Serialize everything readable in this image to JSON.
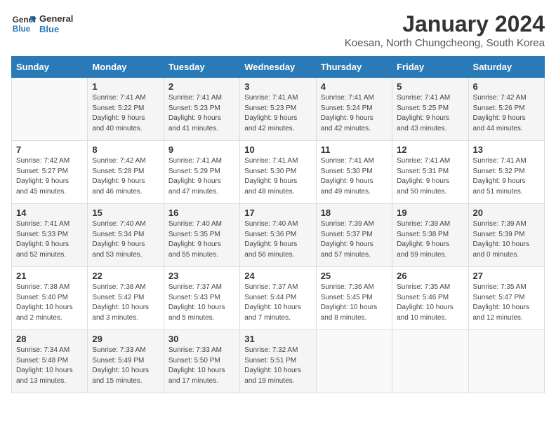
{
  "logo": {
    "line1": "General",
    "line2": "Blue"
  },
  "title": "January 2024",
  "subtitle": "Koesan, North Chungcheong, South Korea",
  "days_header": [
    "Sunday",
    "Monday",
    "Tuesday",
    "Wednesday",
    "Thursday",
    "Friday",
    "Saturday"
  ],
  "weeks": [
    [
      {
        "day": "",
        "sunrise": "",
        "sunset": "",
        "daylight": ""
      },
      {
        "day": "1",
        "sunrise": "Sunrise: 7:41 AM",
        "sunset": "Sunset: 5:22 PM",
        "daylight": "Daylight: 9 hours and 40 minutes."
      },
      {
        "day": "2",
        "sunrise": "Sunrise: 7:41 AM",
        "sunset": "Sunset: 5:23 PM",
        "daylight": "Daylight: 9 hours and 41 minutes."
      },
      {
        "day": "3",
        "sunrise": "Sunrise: 7:41 AM",
        "sunset": "Sunset: 5:23 PM",
        "daylight": "Daylight: 9 hours and 42 minutes."
      },
      {
        "day": "4",
        "sunrise": "Sunrise: 7:41 AM",
        "sunset": "Sunset: 5:24 PM",
        "daylight": "Daylight: 9 hours and 42 minutes."
      },
      {
        "day": "5",
        "sunrise": "Sunrise: 7:41 AM",
        "sunset": "Sunset: 5:25 PM",
        "daylight": "Daylight: 9 hours and 43 minutes."
      },
      {
        "day": "6",
        "sunrise": "Sunrise: 7:42 AM",
        "sunset": "Sunset: 5:26 PM",
        "daylight": "Daylight: 9 hours and 44 minutes."
      }
    ],
    [
      {
        "day": "7",
        "sunrise": "Sunrise: 7:42 AM",
        "sunset": "Sunset: 5:27 PM",
        "daylight": "Daylight: 9 hours and 45 minutes."
      },
      {
        "day": "8",
        "sunrise": "Sunrise: 7:42 AM",
        "sunset": "Sunset: 5:28 PM",
        "daylight": "Daylight: 9 hours and 46 minutes."
      },
      {
        "day": "9",
        "sunrise": "Sunrise: 7:41 AM",
        "sunset": "Sunset: 5:29 PM",
        "daylight": "Daylight: 9 hours and 47 minutes."
      },
      {
        "day": "10",
        "sunrise": "Sunrise: 7:41 AM",
        "sunset": "Sunset: 5:30 PM",
        "daylight": "Daylight: 9 hours and 48 minutes."
      },
      {
        "day": "11",
        "sunrise": "Sunrise: 7:41 AM",
        "sunset": "Sunset: 5:30 PM",
        "daylight": "Daylight: 9 hours and 49 minutes."
      },
      {
        "day": "12",
        "sunrise": "Sunrise: 7:41 AM",
        "sunset": "Sunset: 5:31 PM",
        "daylight": "Daylight: 9 hours and 50 minutes."
      },
      {
        "day": "13",
        "sunrise": "Sunrise: 7:41 AM",
        "sunset": "Sunset: 5:32 PM",
        "daylight": "Daylight: 9 hours and 51 minutes."
      }
    ],
    [
      {
        "day": "14",
        "sunrise": "Sunrise: 7:41 AM",
        "sunset": "Sunset: 5:33 PM",
        "daylight": "Daylight: 9 hours and 52 minutes."
      },
      {
        "day": "15",
        "sunrise": "Sunrise: 7:40 AM",
        "sunset": "Sunset: 5:34 PM",
        "daylight": "Daylight: 9 hours and 53 minutes."
      },
      {
        "day": "16",
        "sunrise": "Sunrise: 7:40 AM",
        "sunset": "Sunset: 5:35 PM",
        "daylight": "Daylight: 9 hours and 55 minutes."
      },
      {
        "day": "17",
        "sunrise": "Sunrise: 7:40 AM",
        "sunset": "Sunset: 5:36 PM",
        "daylight": "Daylight: 9 hours and 56 minutes."
      },
      {
        "day": "18",
        "sunrise": "Sunrise: 7:39 AM",
        "sunset": "Sunset: 5:37 PM",
        "daylight": "Daylight: 9 hours and 57 minutes."
      },
      {
        "day": "19",
        "sunrise": "Sunrise: 7:39 AM",
        "sunset": "Sunset: 5:38 PM",
        "daylight": "Daylight: 9 hours and 59 minutes."
      },
      {
        "day": "20",
        "sunrise": "Sunrise: 7:39 AM",
        "sunset": "Sunset: 5:39 PM",
        "daylight": "Daylight: 10 hours and 0 minutes."
      }
    ],
    [
      {
        "day": "21",
        "sunrise": "Sunrise: 7:38 AM",
        "sunset": "Sunset: 5:40 PM",
        "daylight": "Daylight: 10 hours and 2 minutes."
      },
      {
        "day": "22",
        "sunrise": "Sunrise: 7:38 AM",
        "sunset": "Sunset: 5:42 PM",
        "daylight": "Daylight: 10 hours and 3 minutes."
      },
      {
        "day": "23",
        "sunrise": "Sunrise: 7:37 AM",
        "sunset": "Sunset: 5:43 PM",
        "daylight": "Daylight: 10 hours and 5 minutes."
      },
      {
        "day": "24",
        "sunrise": "Sunrise: 7:37 AM",
        "sunset": "Sunset: 5:44 PM",
        "daylight": "Daylight: 10 hours and 7 minutes."
      },
      {
        "day": "25",
        "sunrise": "Sunrise: 7:36 AM",
        "sunset": "Sunset: 5:45 PM",
        "daylight": "Daylight: 10 hours and 8 minutes."
      },
      {
        "day": "26",
        "sunrise": "Sunrise: 7:35 AM",
        "sunset": "Sunset: 5:46 PM",
        "daylight": "Daylight: 10 hours and 10 minutes."
      },
      {
        "day": "27",
        "sunrise": "Sunrise: 7:35 AM",
        "sunset": "Sunset: 5:47 PM",
        "daylight": "Daylight: 10 hours and 12 minutes."
      }
    ],
    [
      {
        "day": "28",
        "sunrise": "Sunrise: 7:34 AM",
        "sunset": "Sunset: 5:48 PM",
        "daylight": "Daylight: 10 hours and 13 minutes."
      },
      {
        "day": "29",
        "sunrise": "Sunrise: 7:33 AM",
        "sunset": "Sunset: 5:49 PM",
        "daylight": "Daylight: 10 hours and 15 minutes."
      },
      {
        "day": "30",
        "sunrise": "Sunrise: 7:33 AM",
        "sunset": "Sunset: 5:50 PM",
        "daylight": "Daylight: 10 hours and 17 minutes."
      },
      {
        "day": "31",
        "sunrise": "Sunrise: 7:32 AM",
        "sunset": "Sunset: 5:51 PM",
        "daylight": "Daylight: 10 hours and 19 minutes."
      },
      {
        "day": "",
        "sunrise": "",
        "sunset": "",
        "daylight": ""
      },
      {
        "day": "",
        "sunrise": "",
        "sunset": "",
        "daylight": ""
      },
      {
        "day": "",
        "sunrise": "",
        "sunset": "",
        "daylight": ""
      }
    ]
  ]
}
